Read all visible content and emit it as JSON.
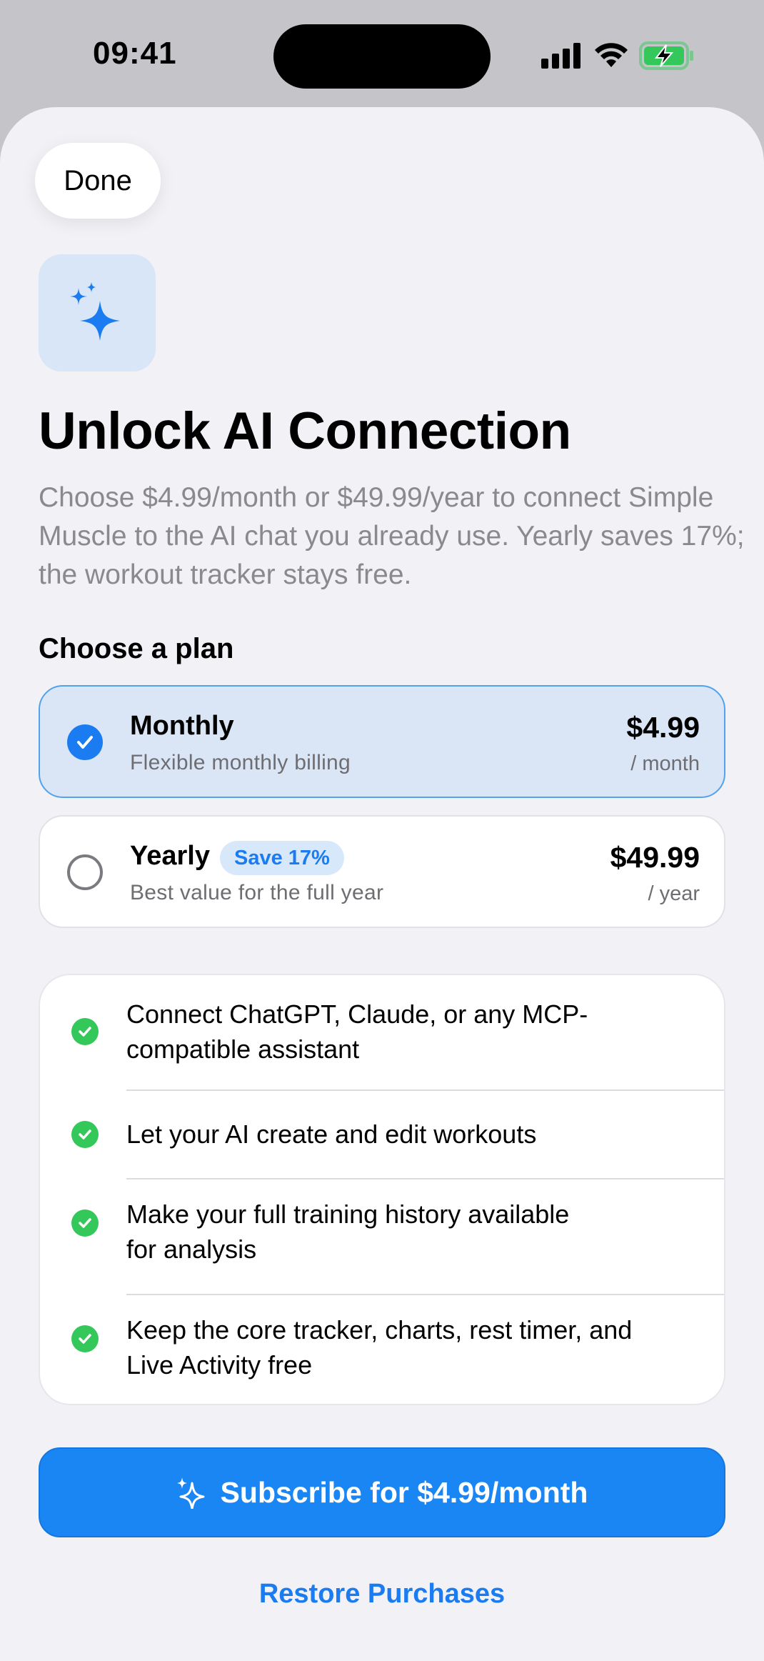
{
  "status_bar": {
    "time": "09:41",
    "icons": [
      "cellular-signal-icon",
      "wifi-icon",
      "battery-charging-icon"
    ],
    "battery_color": "#34c759"
  },
  "sheet": {
    "done_label": "Done",
    "hero_icon": "sparkles-icon",
    "title": "Unlock AI Connection",
    "subtitle": "Choose $4.99/month or $49.99/year to connect Simple Muscle to the AI chat you already use. Yearly saves 17%; the workout tracker stays free.",
    "plan_section_label": "Choose a plan",
    "plans": [
      {
        "name": "Monthly",
        "description": "Flexible monthly billing",
        "price": "$4.99",
        "period": "/ month",
        "selected": true
      },
      {
        "name": "Yearly",
        "badge": "Save 17%",
        "description": "Best value for the full year",
        "price": "$49.99",
        "period": "/ year",
        "selected": false
      }
    ],
    "features": [
      "Connect ChatGPT, Claude, or any MCP-compatible assistant",
      "Let your AI create and edit workouts",
      "Make your full training history available for analysis",
      "Keep the core tracker, charts, rest timer, and Live Activity free"
    ],
    "subscribe_label": "Subscribe for $4.99/month",
    "restore_label": "Restore Purchases"
  },
  "colors": {
    "accent": "#1a7cf0",
    "success": "#34c759",
    "selected_plan_bg": "#dae6f6",
    "sheet_bg": "#f1f1f6"
  }
}
